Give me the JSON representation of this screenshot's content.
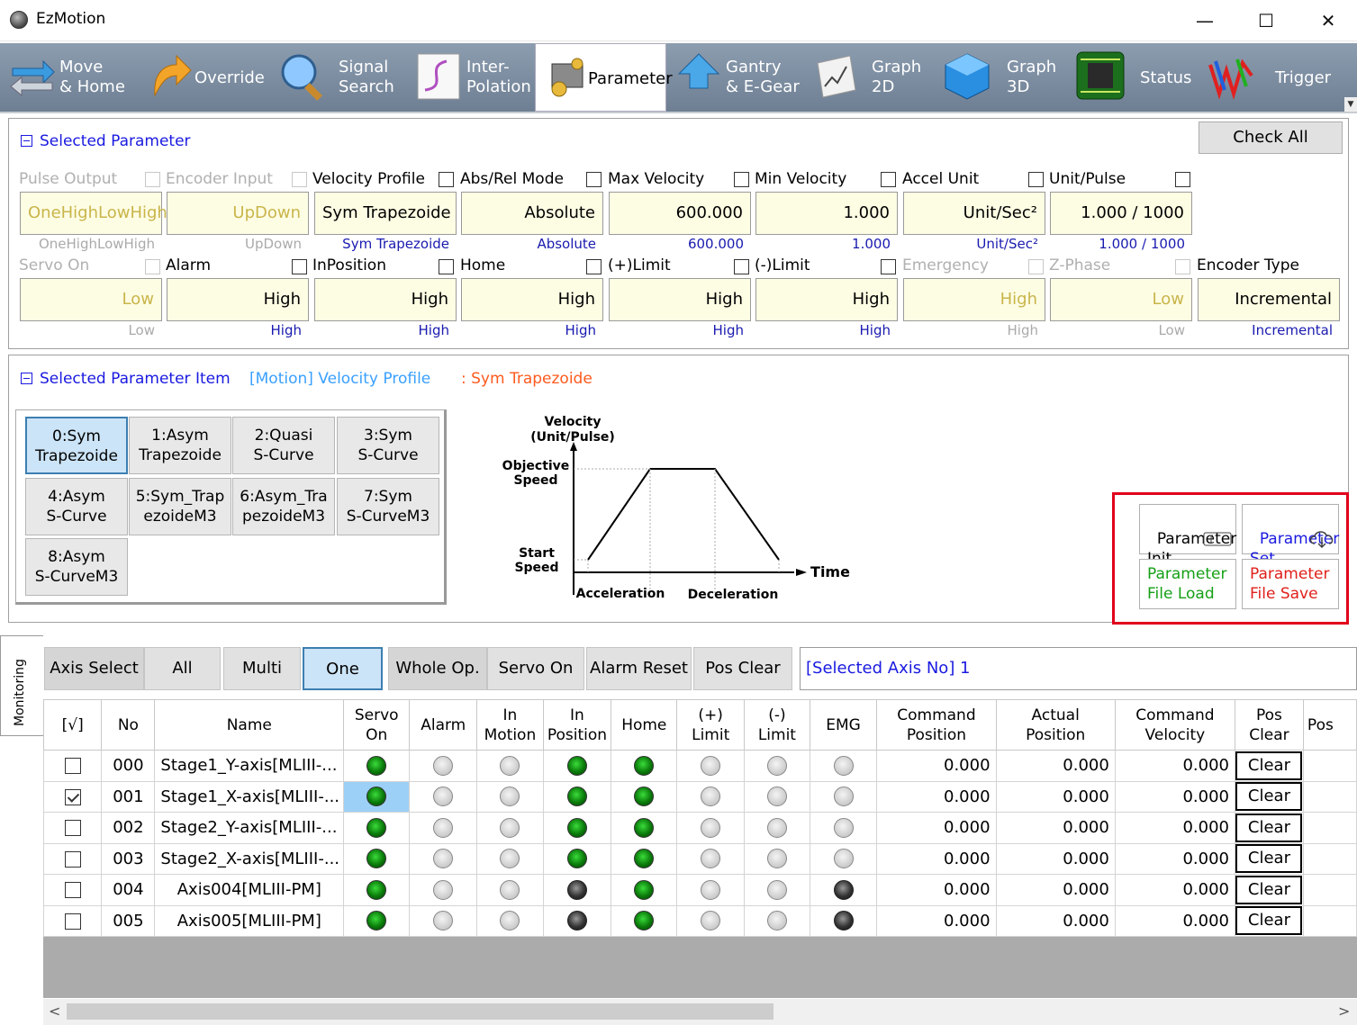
{
  "window": {
    "title": "EzMotion",
    "minimize": "—",
    "maximize": "☐",
    "close": "✕"
  },
  "toolbar": [
    {
      "label": "Move\n& Home",
      "icon": "move-home-icon"
    },
    {
      "label": "Override",
      "icon": "override-icon"
    },
    {
      "label": "Signal\nSearch",
      "icon": "signal-search-icon"
    },
    {
      "label": "Inter-\nPolation",
      "icon": "interpolation-icon"
    },
    {
      "label": "Parameter",
      "icon": "parameter-icon"
    },
    {
      "label": "Gantry\n& E-Gear",
      "icon": "gantry-icon"
    },
    {
      "label": "Graph\n2D",
      "icon": "graph-2d-icon"
    },
    {
      "label": "Graph\n3D",
      "icon": "graph-3d-icon"
    },
    {
      "label": "Status",
      "icon": "status-icon"
    },
    {
      "label": "Trigger",
      "icon": "trigger-icon"
    }
  ],
  "selected_parameter": {
    "title": "Selected Parameter",
    "check_all": "Check All",
    "row1": [
      {
        "label": "Pulse Output",
        "value": "OneHighLowHigh",
        "sub": "OneHighLowHigh",
        "dim": true
      },
      {
        "label": "Encoder Input",
        "value": "UpDown",
        "sub": "UpDown",
        "dim": true
      },
      {
        "label": "Velocity Profile",
        "value": "Sym Trapezoide",
        "sub": "Sym Trapezoide",
        "dim": false
      },
      {
        "label": "Abs/Rel Mode",
        "value": "Absolute",
        "sub": "Absolute",
        "dim": false
      },
      {
        "label": "Max Velocity",
        "value": "600.000",
        "sub": "600.000",
        "dim": false
      },
      {
        "label": "Min Velocity",
        "value": "1.000",
        "sub": "1.000",
        "dim": false
      },
      {
        "label": "Accel Unit",
        "value": "Unit/Sec²",
        "sub": "Unit/Sec²",
        "dim": false
      },
      {
        "label": "Unit/Pulse",
        "value": "1.000 / 1000",
        "sub": "1.000 / 1000",
        "dim": false
      }
    ],
    "row2": [
      {
        "label": "Servo On",
        "value": "Low",
        "sub": "Low",
        "dim": true
      },
      {
        "label": "Alarm",
        "value": "High",
        "sub": "High",
        "dim": false
      },
      {
        "label": "InPosition",
        "value": "High",
        "sub": "High",
        "dim": false
      },
      {
        "label": "Home",
        "value": "High",
        "sub": "High",
        "dim": false
      },
      {
        "label": "(+)Limit",
        "value": "High",
        "sub": "High",
        "dim": false
      },
      {
        "label": "(-)Limit",
        "value": "High",
        "sub": "High",
        "dim": false
      },
      {
        "label": "Emergency",
        "value": "High",
        "sub": "High",
        "dim": true
      },
      {
        "label": "Z-Phase",
        "value": "Low",
        "sub": "Low",
        "dim": true
      },
      {
        "label": "Encoder Type",
        "value": "Incremental",
        "sub": "Incremental",
        "dim": false
      }
    ]
  },
  "selected_item": {
    "title": "Selected Parameter Item",
    "category": "[Motion] Velocity Profile",
    "value": ": Sym Trapezoide",
    "options": [
      "0:Sym\nTrapezoide",
      "1:Asym\nTrapezoide",
      "2:Quasi\nS-Curve",
      "3:Sym\nS-Curve",
      "4:Asym\nS-Curve",
      "5:Sym_Trap\nezoideM3",
      "6:Asym_Tra\npezoideM3",
      "7:Sym\nS-CurveM3",
      "8:Asym\nS-CurveM3"
    ],
    "selected_index": 0,
    "diagram": {
      "y_title_1": "Velocity",
      "y_title_2": "(Unit/Pulse)",
      "objective_1": "Objective",
      "objective_2": "Speed",
      "start_1": "Start",
      "start_2": "Speed",
      "x_title": "Time",
      "accel": "Acceleration",
      "decel": "Deceleration"
    }
  },
  "param_buttons": {
    "init": "Parameter\nInit",
    "set": "Parameter\nSet",
    "load": "Parameter\nFile Load",
    "save": "Parameter\nFile Save",
    "colors": {
      "init": "#000000",
      "set": "#1a1ae0",
      "load": "#16a016",
      "save": "#e0201b"
    }
  },
  "monitoring": {
    "tab": "Monitoring",
    "axis_select": "Axis Select",
    "all": "All",
    "multi": "Multi",
    "one": "One",
    "whole_op": "Whole Op.",
    "servo_on": "Servo On",
    "alarm_reset": "Alarm Reset",
    "pos_clear": "Pos Clear",
    "selected_axis": "[Selected Axis No] 1",
    "columns": [
      "[√]",
      "No",
      "Name",
      "Servo\nOn",
      "Alarm",
      "In\nMotion",
      "In\nPosition",
      "Home",
      "(+)\nLimit",
      "(-)\nLimit",
      "EMG",
      "Command\nPosition",
      "Actual\nPosition",
      "Command\nVelocity",
      "Pos\nClear",
      "Pos"
    ],
    "rows": [
      {
        "checked": false,
        "no": "000",
        "name": "Stage1_Y-axis[MLIII-...",
        "leds": [
          "green",
          "gray",
          "gray",
          "green",
          "green",
          "gray",
          "gray",
          "gray"
        ],
        "cmd_pos": "0.000",
        "act_pos": "0.000",
        "cmd_vel": "0.000",
        "clear": "Clear"
      },
      {
        "checked": true,
        "no": "001",
        "name": "Stage1_X-axis[MLIII-...",
        "leds": [
          "green",
          "gray",
          "gray",
          "green",
          "green",
          "gray",
          "gray",
          "gray"
        ],
        "cmd_pos": "0.000",
        "act_pos": "0.000",
        "cmd_vel": "0.000",
        "clear": "Clear"
      },
      {
        "checked": false,
        "no": "002",
        "name": "Stage2_Y-axis[MLIII-...",
        "leds": [
          "green",
          "gray",
          "gray",
          "green",
          "green",
          "gray",
          "gray",
          "gray"
        ],
        "cmd_pos": "0.000",
        "act_pos": "0.000",
        "cmd_vel": "0.000",
        "clear": "Clear"
      },
      {
        "checked": false,
        "no": "003",
        "name": "Stage2_X-axis[MLIII-...",
        "leds": [
          "green",
          "gray",
          "gray",
          "green",
          "green",
          "gray",
          "gray",
          "gray"
        ],
        "cmd_pos": "0.000",
        "act_pos": "0.000",
        "cmd_vel": "0.000",
        "clear": "Clear"
      },
      {
        "checked": false,
        "no": "004",
        "name": "Axis004[MLIII-PM]",
        "leds": [
          "green",
          "gray",
          "gray",
          "black",
          "green",
          "gray",
          "gray",
          "black"
        ],
        "cmd_pos": "0.000",
        "act_pos": "0.000",
        "cmd_vel": "0.000",
        "clear": "Clear"
      },
      {
        "checked": false,
        "no": "005",
        "name": "Axis005[MLIII-PM]",
        "leds": [
          "green",
          "gray",
          "gray",
          "black",
          "green",
          "gray",
          "gray",
          "black"
        ],
        "cmd_pos": "0.000",
        "act_pos": "0.000",
        "cmd_vel": "0.000",
        "clear": "Clear"
      }
    ]
  }
}
